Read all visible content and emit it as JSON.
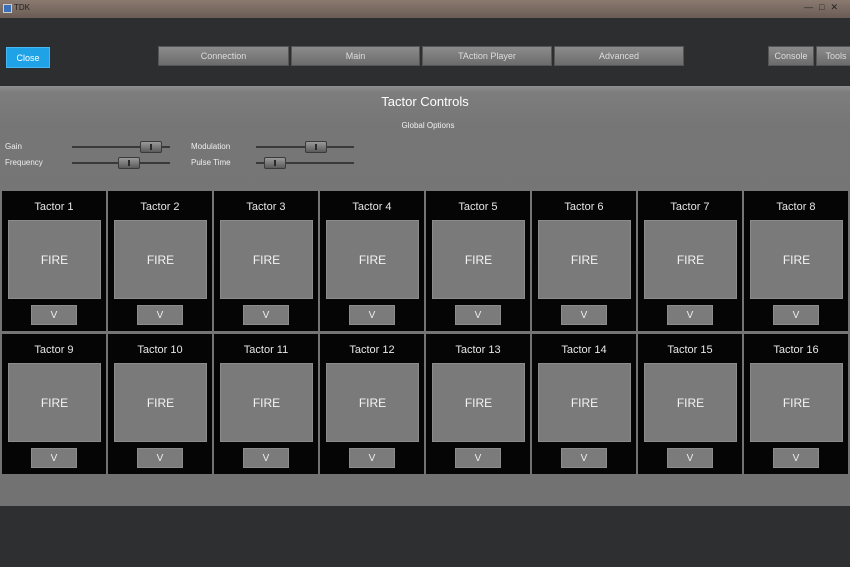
{
  "window": {
    "title": "TDK"
  },
  "toolbar": {
    "close_label": "Close",
    "tabs": [
      {
        "label": "Connection"
      },
      {
        "label": "Main"
      },
      {
        "label": "TAction Player"
      },
      {
        "label": "Advanced"
      }
    ],
    "console_label": "Console",
    "tools_label": "Tools"
  },
  "main": {
    "title": "Tactor Controls",
    "global_options_label": "Global Options",
    "options": {
      "gain_label": "Gain",
      "frequency_label": "Frequency",
      "modulation_label": "Modulation",
      "pulse_time_label": "Pulse Time",
      "gain_value": 0.9,
      "frequency_value": 0.6,
      "modulation_value": 0.65,
      "pulse_time_value": 0.1
    }
  },
  "tactors": [
    {
      "name": "Tactor 1",
      "fire_label": "FIRE",
      "dropdown_label": "V"
    },
    {
      "name": "Tactor 2",
      "fire_label": "FIRE",
      "dropdown_label": "V"
    },
    {
      "name": "Tactor 3",
      "fire_label": "FIRE",
      "dropdown_label": "V"
    },
    {
      "name": "Tactor 4",
      "fire_label": "FIRE",
      "dropdown_label": "V"
    },
    {
      "name": "Tactor 5",
      "fire_label": "FIRE",
      "dropdown_label": "V"
    },
    {
      "name": "Tactor 6",
      "fire_label": "FIRE",
      "dropdown_label": "V"
    },
    {
      "name": "Tactor 7",
      "fire_label": "FIRE",
      "dropdown_label": "V"
    },
    {
      "name": "Tactor 8",
      "fire_label": "FIRE",
      "dropdown_label": "V"
    },
    {
      "name": "Tactor 9",
      "fire_label": "FIRE",
      "dropdown_label": "V"
    },
    {
      "name": "Tactor 10",
      "fire_label": "FIRE",
      "dropdown_label": "V"
    },
    {
      "name": "Tactor 11",
      "fire_label": "FIRE",
      "dropdown_label": "V"
    },
    {
      "name": "Tactor 12",
      "fire_label": "FIRE",
      "dropdown_label": "V"
    },
    {
      "name": "Tactor 13",
      "fire_label": "FIRE",
      "dropdown_label": "V"
    },
    {
      "name": "Tactor 14",
      "fire_label": "FIRE",
      "dropdown_label": "V"
    },
    {
      "name": "Tactor 15",
      "fire_label": "FIRE",
      "dropdown_label": "V"
    },
    {
      "name": "Tactor 16",
      "fire_label": "FIRE",
      "dropdown_label": "V"
    }
  ],
  "colors": {
    "accent": "#1fa3e6",
    "tile_background": "#050505",
    "fire_button": "#7a7a7a",
    "panel": "#767676",
    "chrome": "#2e2f31"
  }
}
